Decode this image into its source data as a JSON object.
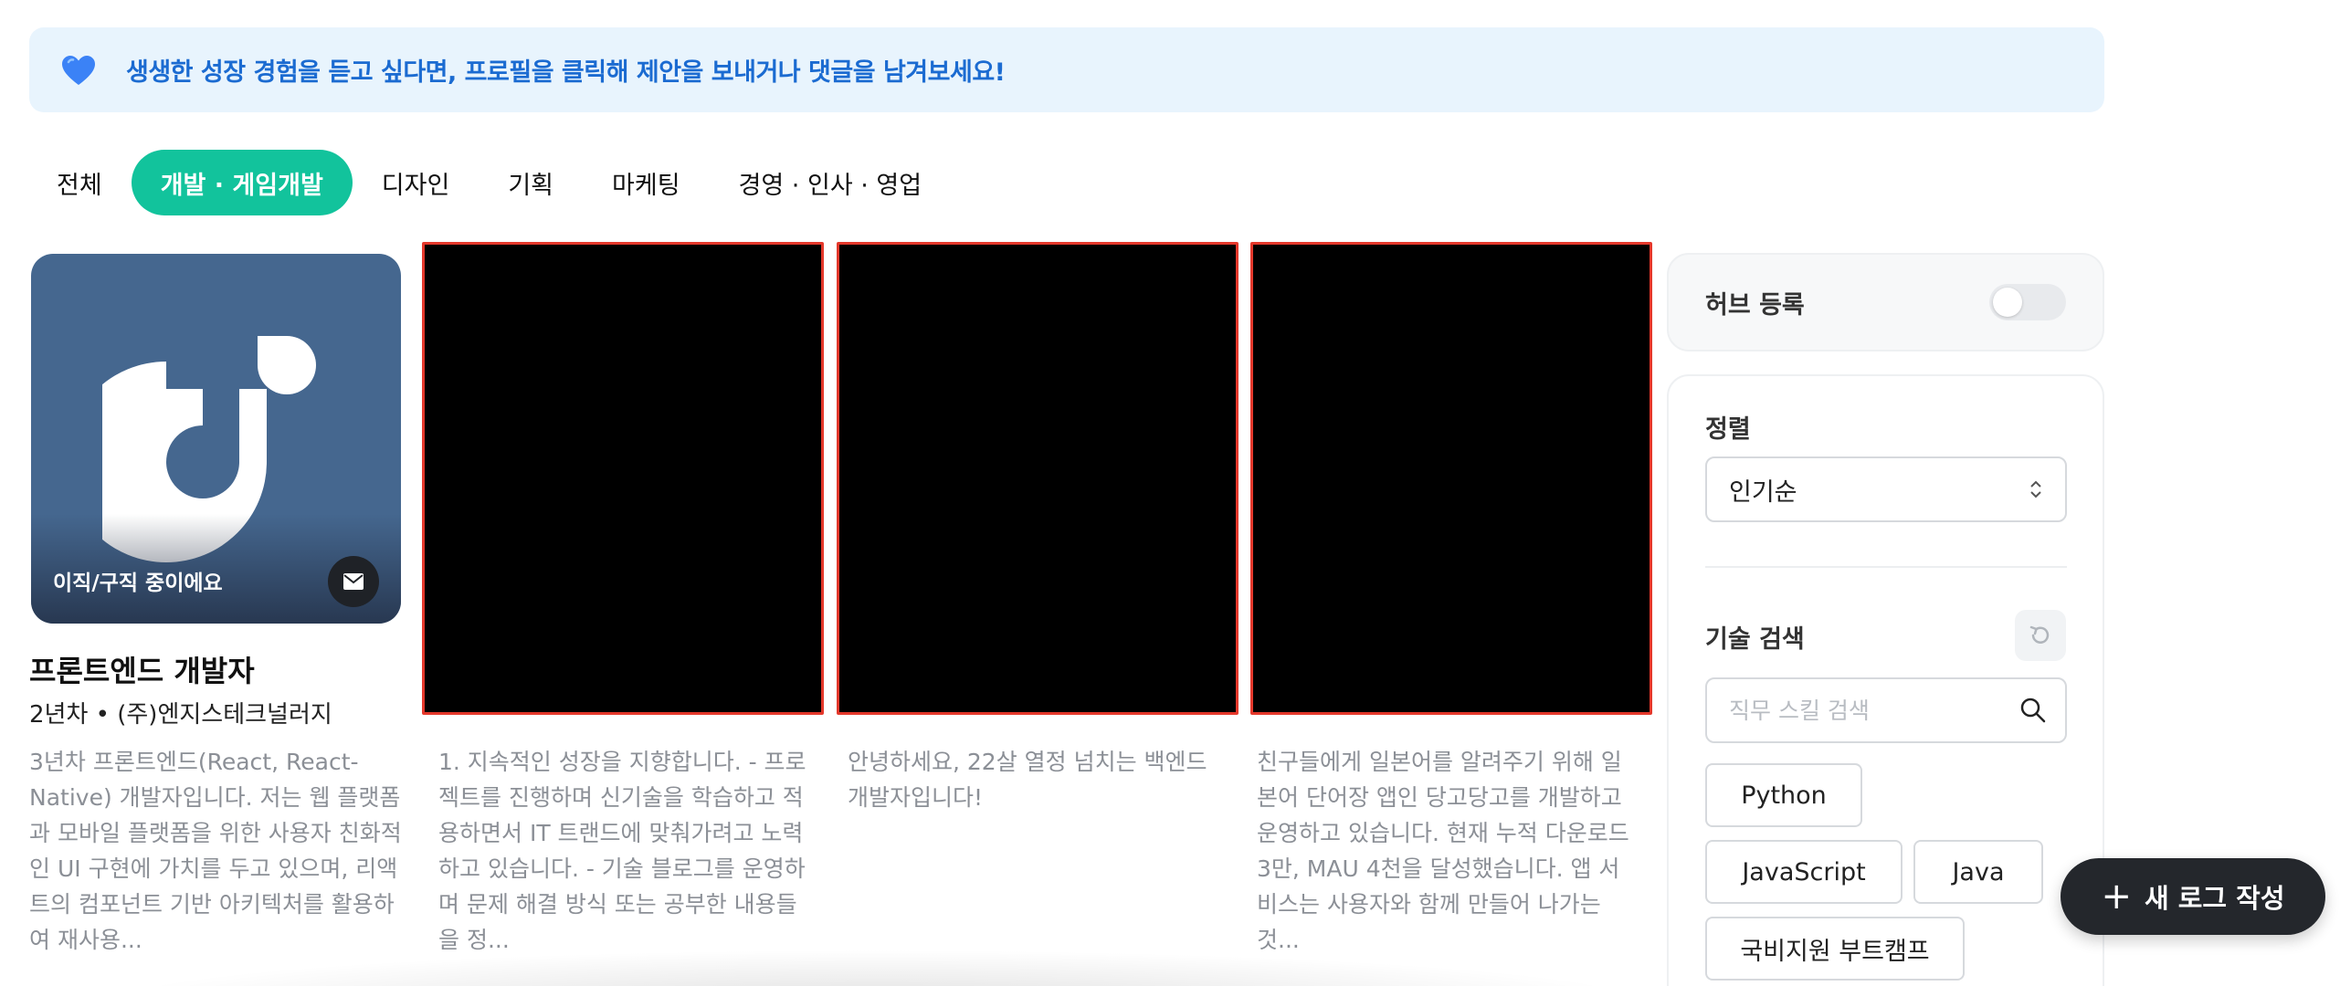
{
  "banner": {
    "message": "생생한 성장 경험을 듣고 싶다면, 프로필을 클릭해 제안을 보내거나 댓글을 남겨보세요!",
    "icon": "heart-icon",
    "accent_color": "#1b6bd1",
    "background_color": "#e8f4fd"
  },
  "tabs": [
    {
      "label": "전체",
      "active": false
    },
    {
      "label": "개발 · 게임개발",
      "active": true
    },
    {
      "label": "디자인",
      "active": false
    },
    {
      "label": "기획",
      "active": false
    },
    {
      "label": "마케팅",
      "active": false
    },
    {
      "label": "경영 · 인사 · 영업",
      "active": false
    }
  ],
  "active_tab_color": "#12c39c",
  "cards": [
    {
      "status": "이직/구직 중이에요",
      "title": "프론트엔드 개발자",
      "subtitle": "2년차 • (주)엔지스테크널러지",
      "description": "3년차 프론트엔드(React, React-Native) 개발자입니다. 저는 웹 플랫폼과 모바일 플랫폼을 위한 사용자 친화적인 UI 구현에 가치를 두고 있으며, 리액트의 컴포넌트 기반 아키텍처를 활용하여 재사용..."
    },
    {
      "description": "1. 지속적인 성장을 지향합니다. - 프로젝트를 진행하며 신기술을 학습하고 적용하면서 IT 트랜드에 맞춰가려고 노력하고 있습니다. - 기술 블로그를 운영하며 문제 해결 방식 또는 공부한 내용들을 정..."
    },
    {
      "description": "안녕하세요, 22살 열정 넘치는 백엔드 개발자입니다!"
    },
    {
      "description": "친구들에게 일본어를 알려주기 위해 일본어 단어장 앱인 당고당고를 개발하고 운영하고 있습니다. 현재 누적 다운로드 3만, MAU 4천을 달성했습니다. 앱 서비스는 사용자와 함께 만들어 나가는 것..."
    }
  ],
  "sidebar": {
    "hub_label": "허브 등록",
    "sort_title": "정렬",
    "sort_value": "인기순",
    "skill_title": "기술 검색",
    "search_placeholder": "직무 스킬 검색",
    "chips": [
      "Python",
      "JavaScript",
      "Java",
      "국비지원 부트캠프"
    ]
  },
  "fab": {
    "label": "새 로그 작성",
    "plus": "+"
  }
}
